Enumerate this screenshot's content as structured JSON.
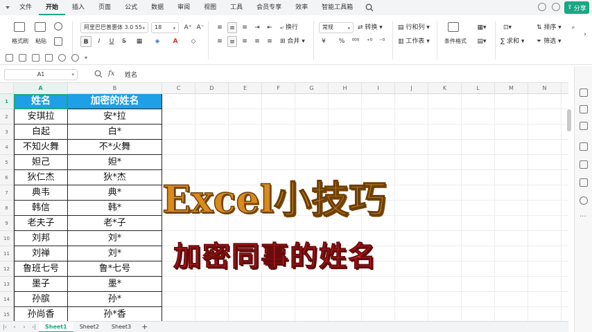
{
  "menu": {
    "items": [
      "文件",
      "开始",
      "插入",
      "页面",
      "公式",
      "数据",
      "审阅",
      "视图",
      "工具",
      "会员专享",
      "效率",
      "智能工具箱"
    ],
    "active_index": 1,
    "share_label": "分享"
  },
  "ribbon": {
    "format_painter": "格式刷",
    "paste": "粘贴",
    "font_name": "阿里巴巴普惠体 3.0 55",
    "font_size": "18",
    "wrap": "换行",
    "merge": "合并",
    "number_format": "常规",
    "convert": "转换",
    "rows_cols": "行和列",
    "worksheet": "工作表",
    "cond_format": "条件格式",
    "sort": "排序",
    "sum": "求和",
    "filter": "筛选",
    "bold": "B",
    "italic": "I",
    "underline": "U",
    "currency": "¥",
    "percent": "%"
  },
  "formula_bar": {
    "cell_ref": "A1",
    "fx": "fx",
    "content": "姓名"
  },
  "columns": [
    "A",
    "B",
    "C",
    "D",
    "E",
    "F",
    "G",
    "H",
    "I",
    "J",
    "K",
    "L",
    "M",
    "N"
  ],
  "rows": [
    "1",
    "2",
    "3",
    "4",
    "5",
    "6",
    "7",
    "8",
    "9",
    "10",
    "11",
    "12",
    "13",
    "14",
    "15"
  ],
  "table": {
    "headers": [
      "姓名",
      "加密的姓名"
    ],
    "names": [
      "安琪拉",
      "白起",
      "不知火舞",
      "妲己",
      "狄仁杰",
      "典韦",
      "韩信",
      "老夫子",
      "刘邦",
      "刘禅",
      "鲁班七号",
      "墨子",
      "孙膑",
      "孙尚香"
    ],
    "encrypted": [
      "安*拉",
      "白*",
      "不*火舞",
      "妲*",
      "狄*杰",
      "典*",
      "韩*",
      "老*子",
      "刘*",
      "刘*",
      "鲁*七号",
      "墨*",
      "孙*",
      "孙*香"
    ]
  },
  "overlay": {
    "title": "Excel小技巧",
    "subtitle": "加密同事的姓名"
  },
  "sheets": [
    "Sheet1",
    "Sheet2",
    "Sheet3"
  ],
  "sheet_active": 0,
  "add_sheet": "+",
  "colors": {
    "accent": "#1ba784",
    "header_fill": "#1f9fe5",
    "title_orange": "#d98a1c",
    "subtitle_red": "#e0202a"
  }
}
